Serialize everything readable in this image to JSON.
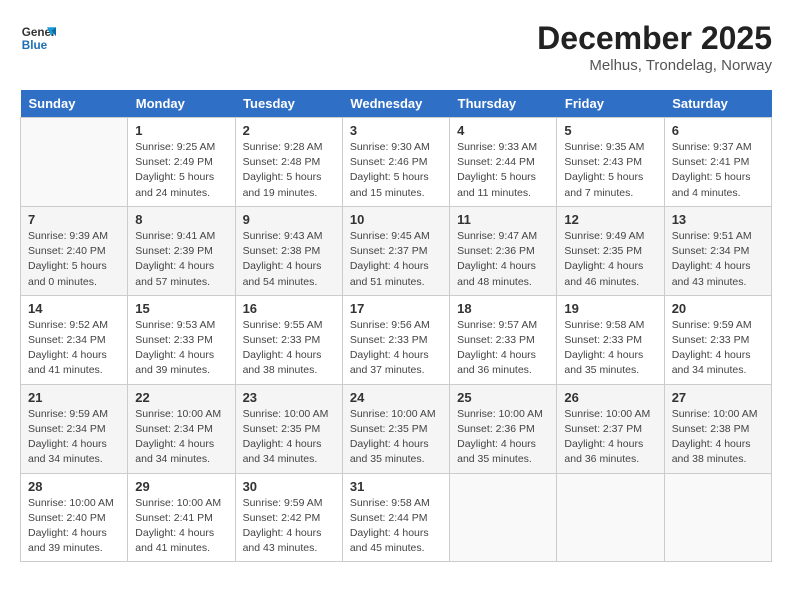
{
  "header": {
    "logo_line1": "General",
    "logo_line2": "Blue",
    "month": "December 2025",
    "location": "Melhus, Trondelag, Norway"
  },
  "days_of_week": [
    "Sunday",
    "Monday",
    "Tuesday",
    "Wednesday",
    "Thursday",
    "Friday",
    "Saturday"
  ],
  "weeks": [
    [
      {
        "day": "",
        "sunrise": "",
        "sunset": "",
        "daylight": ""
      },
      {
        "day": "1",
        "sunrise": "Sunrise: 9:25 AM",
        "sunset": "Sunset: 2:49 PM",
        "daylight": "Daylight: 5 hours and 24 minutes."
      },
      {
        "day": "2",
        "sunrise": "Sunrise: 9:28 AM",
        "sunset": "Sunset: 2:48 PM",
        "daylight": "Daylight: 5 hours and 19 minutes."
      },
      {
        "day": "3",
        "sunrise": "Sunrise: 9:30 AM",
        "sunset": "Sunset: 2:46 PM",
        "daylight": "Daylight: 5 hours and 15 minutes."
      },
      {
        "day": "4",
        "sunrise": "Sunrise: 9:33 AM",
        "sunset": "Sunset: 2:44 PM",
        "daylight": "Daylight: 5 hours and 11 minutes."
      },
      {
        "day": "5",
        "sunrise": "Sunrise: 9:35 AM",
        "sunset": "Sunset: 2:43 PM",
        "daylight": "Daylight: 5 hours and 7 minutes."
      },
      {
        "day": "6",
        "sunrise": "Sunrise: 9:37 AM",
        "sunset": "Sunset: 2:41 PM",
        "daylight": "Daylight: 5 hours and 4 minutes."
      }
    ],
    [
      {
        "day": "7",
        "sunrise": "Sunrise: 9:39 AM",
        "sunset": "Sunset: 2:40 PM",
        "daylight": "Daylight: 5 hours and 0 minutes."
      },
      {
        "day": "8",
        "sunrise": "Sunrise: 9:41 AM",
        "sunset": "Sunset: 2:39 PM",
        "daylight": "Daylight: 4 hours and 57 minutes."
      },
      {
        "day": "9",
        "sunrise": "Sunrise: 9:43 AM",
        "sunset": "Sunset: 2:38 PM",
        "daylight": "Daylight: 4 hours and 54 minutes."
      },
      {
        "day": "10",
        "sunrise": "Sunrise: 9:45 AM",
        "sunset": "Sunset: 2:37 PM",
        "daylight": "Daylight: 4 hours and 51 minutes."
      },
      {
        "day": "11",
        "sunrise": "Sunrise: 9:47 AM",
        "sunset": "Sunset: 2:36 PM",
        "daylight": "Daylight: 4 hours and 48 minutes."
      },
      {
        "day": "12",
        "sunrise": "Sunrise: 9:49 AM",
        "sunset": "Sunset: 2:35 PM",
        "daylight": "Daylight: 4 hours and 46 minutes."
      },
      {
        "day": "13",
        "sunrise": "Sunrise: 9:51 AM",
        "sunset": "Sunset: 2:34 PM",
        "daylight": "Daylight: 4 hours and 43 minutes."
      }
    ],
    [
      {
        "day": "14",
        "sunrise": "Sunrise: 9:52 AM",
        "sunset": "Sunset: 2:34 PM",
        "daylight": "Daylight: 4 hours and 41 minutes."
      },
      {
        "day": "15",
        "sunrise": "Sunrise: 9:53 AM",
        "sunset": "Sunset: 2:33 PM",
        "daylight": "Daylight: 4 hours and 39 minutes."
      },
      {
        "day": "16",
        "sunrise": "Sunrise: 9:55 AM",
        "sunset": "Sunset: 2:33 PM",
        "daylight": "Daylight: 4 hours and 38 minutes."
      },
      {
        "day": "17",
        "sunrise": "Sunrise: 9:56 AM",
        "sunset": "Sunset: 2:33 PM",
        "daylight": "Daylight: 4 hours and 37 minutes."
      },
      {
        "day": "18",
        "sunrise": "Sunrise: 9:57 AM",
        "sunset": "Sunset: 2:33 PM",
        "daylight": "Daylight: 4 hours and 36 minutes."
      },
      {
        "day": "19",
        "sunrise": "Sunrise: 9:58 AM",
        "sunset": "Sunset: 2:33 PM",
        "daylight": "Daylight: 4 hours and 35 minutes."
      },
      {
        "day": "20",
        "sunrise": "Sunrise: 9:59 AM",
        "sunset": "Sunset: 2:33 PM",
        "daylight": "Daylight: 4 hours and 34 minutes."
      }
    ],
    [
      {
        "day": "21",
        "sunrise": "Sunrise: 9:59 AM",
        "sunset": "Sunset: 2:34 PM",
        "daylight": "Daylight: 4 hours and 34 minutes."
      },
      {
        "day": "22",
        "sunrise": "Sunrise: 10:00 AM",
        "sunset": "Sunset: 2:34 PM",
        "daylight": "Daylight: 4 hours and 34 minutes."
      },
      {
        "day": "23",
        "sunrise": "Sunrise: 10:00 AM",
        "sunset": "Sunset: 2:35 PM",
        "daylight": "Daylight: 4 hours and 34 minutes."
      },
      {
        "day": "24",
        "sunrise": "Sunrise: 10:00 AM",
        "sunset": "Sunset: 2:35 PM",
        "daylight": "Daylight: 4 hours and 35 minutes."
      },
      {
        "day": "25",
        "sunrise": "Sunrise: 10:00 AM",
        "sunset": "Sunset: 2:36 PM",
        "daylight": "Daylight: 4 hours and 35 minutes."
      },
      {
        "day": "26",
        "sunrise": "Sunrise: 10:00 AM",
        "sunset": "Sunset: 2:37 PM",
        "daylight": "Daylight: 4 hours and 36 minutes."
      },
      {
        "day": "27",
        "sunrise": "Sunrise: 10:00 AM",
        "sunset": "Sunset: 2:38 PM",
        "daylight": "Daylight: 4 hours and 38 minutes."
      }
    ],
    [
      {
        "day": "28",
        "sunrise": "Sunrise: 10:00 AM",
        "sunset": "Sunset: 2:40 PM",
        "daylight": "Daylight: 4 hours and 39 minutes."
      },
      {
        "day": "29",
        "sunrise": "Sunrise: 10:00 AM",
        "sunset": "Sunset: 2:41 PM",
        "daylight": "Daylight: 4 hours and 41 minutes."
      },
      {
        "day": "30",
        "sunrise": "Sunrise: 9:59 AM",
        "sunset": "Sunset: 2:42 PM",
        "daylight": "Daylight: 4 hours and 43 minutes."
      },
      {
        "day": "31",
        "sunrise": "Sunrise: 9:58 AM",
        "sunset": "Sunset: 2:44 PM",
        "daylight": "Daylight: 4 hours and 45 minutes."
      },
      {
        "day": "",
        "sunrise": "",
        "sunset": "",
        "daylight": ""
      },
      {
        "day": "",
        "sunrise": "",
        "sunset": "",
        "daylight": ""
      },
      {
        "day": "",
        "sunrise": "",
        "sunset": "",
        "daylight": ""
      }
    ]
  ]
}
